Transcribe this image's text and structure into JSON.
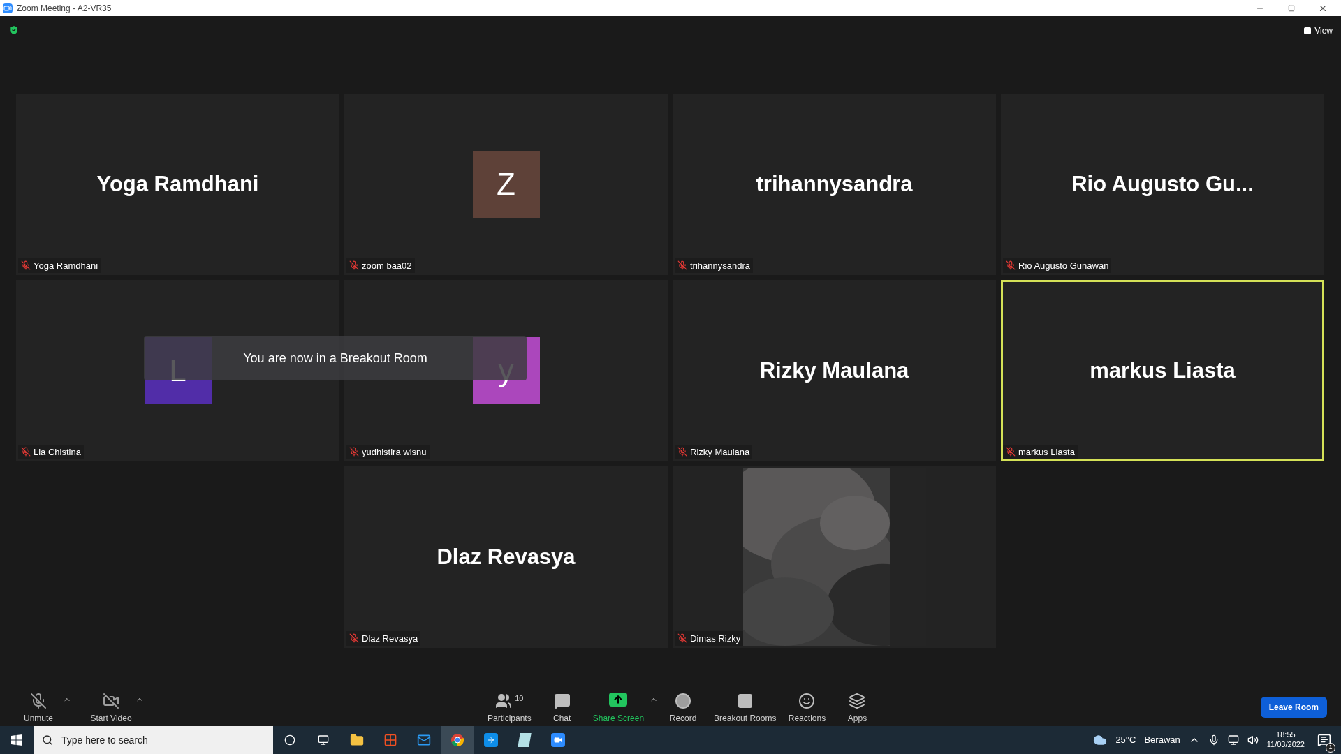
{
  "window": {
    "title": "Zoom Meeting - A2-VR35"
  },
  "top_bar": {
    "view_label": "View"
  },
  "tiles": [
    {
      "kind": "name",
      "display": "Yoga Ramdhani",
      "label": "Yoga Ramdhani",
      "muted": true,
      "active": false
    },
    {
      "kind": "avatar",
      "display": "Z",
      "color": "#5e4138",
      "label": "zoom baa02",
      "muted": true,
      "active": false
    },
    {
      "kind": "name",
      "display": "trihannysandra",
      "label": "trihannysandra",
      "muted": true,
      "active": false
    },
    {
      "kind": "name",
      "display": "Rio Augusto Gu...",
      "label": "Rio Augusto Gunawan",
      "muted": true,
      "active": false
    },
    {
      "kind": "avatar",
      "display": "L",
      "color": "#512da8",
      "label": "Lia Chistina",
      "muted": true,
      "active": false
    },
    {
      "kind": "avatar",
      "display": "y",
      "color": "#ab47bc",
      "label": "yudhistira wisnu",
      "muted": true,
      "active": false
    },
    {
      "kind": "name",
      "display": "Rizky Maulana",
      "label": "Rizky Maulana",
      "muted": true,
      "active": false
    },
    {
      "kind": "name",
      "display": "markus Liasta",
      "label": "markus Liasta",
      "muted": true,
      "active": true
    },
    {
      "kind": "empty"
    },
    {
      "kind": "name",
      "display": "Dlaz Revasya",
      "label": "Dlaz Revasya",
      "muted": true,
      "active": false
    },
    {
      "kind": "video",
      "label": "Dimas Rizky",
      "muted": true,
      "active": false
    }
  ],
  "toast": {
    "text": "You are now in a Breakout Room"
  },
  "toolbar": {
    "items": [
      {
        "kind": "mic-off",
        "label": "Unmute",
        "caret": true
      },
      {
        "kind": "video-off",
        "label": "Start Video",
        "caret": true
      },
      {
        "kind": "participants",
        "label": "Participants",
        "count": "10",
        "caret": false
      },
      {
        "kind": "chat",
        "label": "Chat",
        "caret": false
      },
      {
        "kind": "share",
        "label": "Share Screen",
        "caret": true
      },
      {
        "kind": "record",
        "label": "Record",
        "caret": false
      },
      {
        "kind": "breakout",
        "label": "Breakout Rooms",
        "caret": false
      },
      {
        "kind": "reactions",
        "label": "Reactions",
        "caret": false
      },
      {
        "kind": "apps",
        "label": "Apps",
        "caret": false
      }
    ],
    "leave_button": "Leave Room"
  },
  "taskbar": {
    "search_placeholder": "Type here to search",
    "weather_temp": "25°C",
    "weather_text": "Berawan",
    "time": "18:55",
    "date": "11/03/2022",
    "notification_count": "1"
  }
}
